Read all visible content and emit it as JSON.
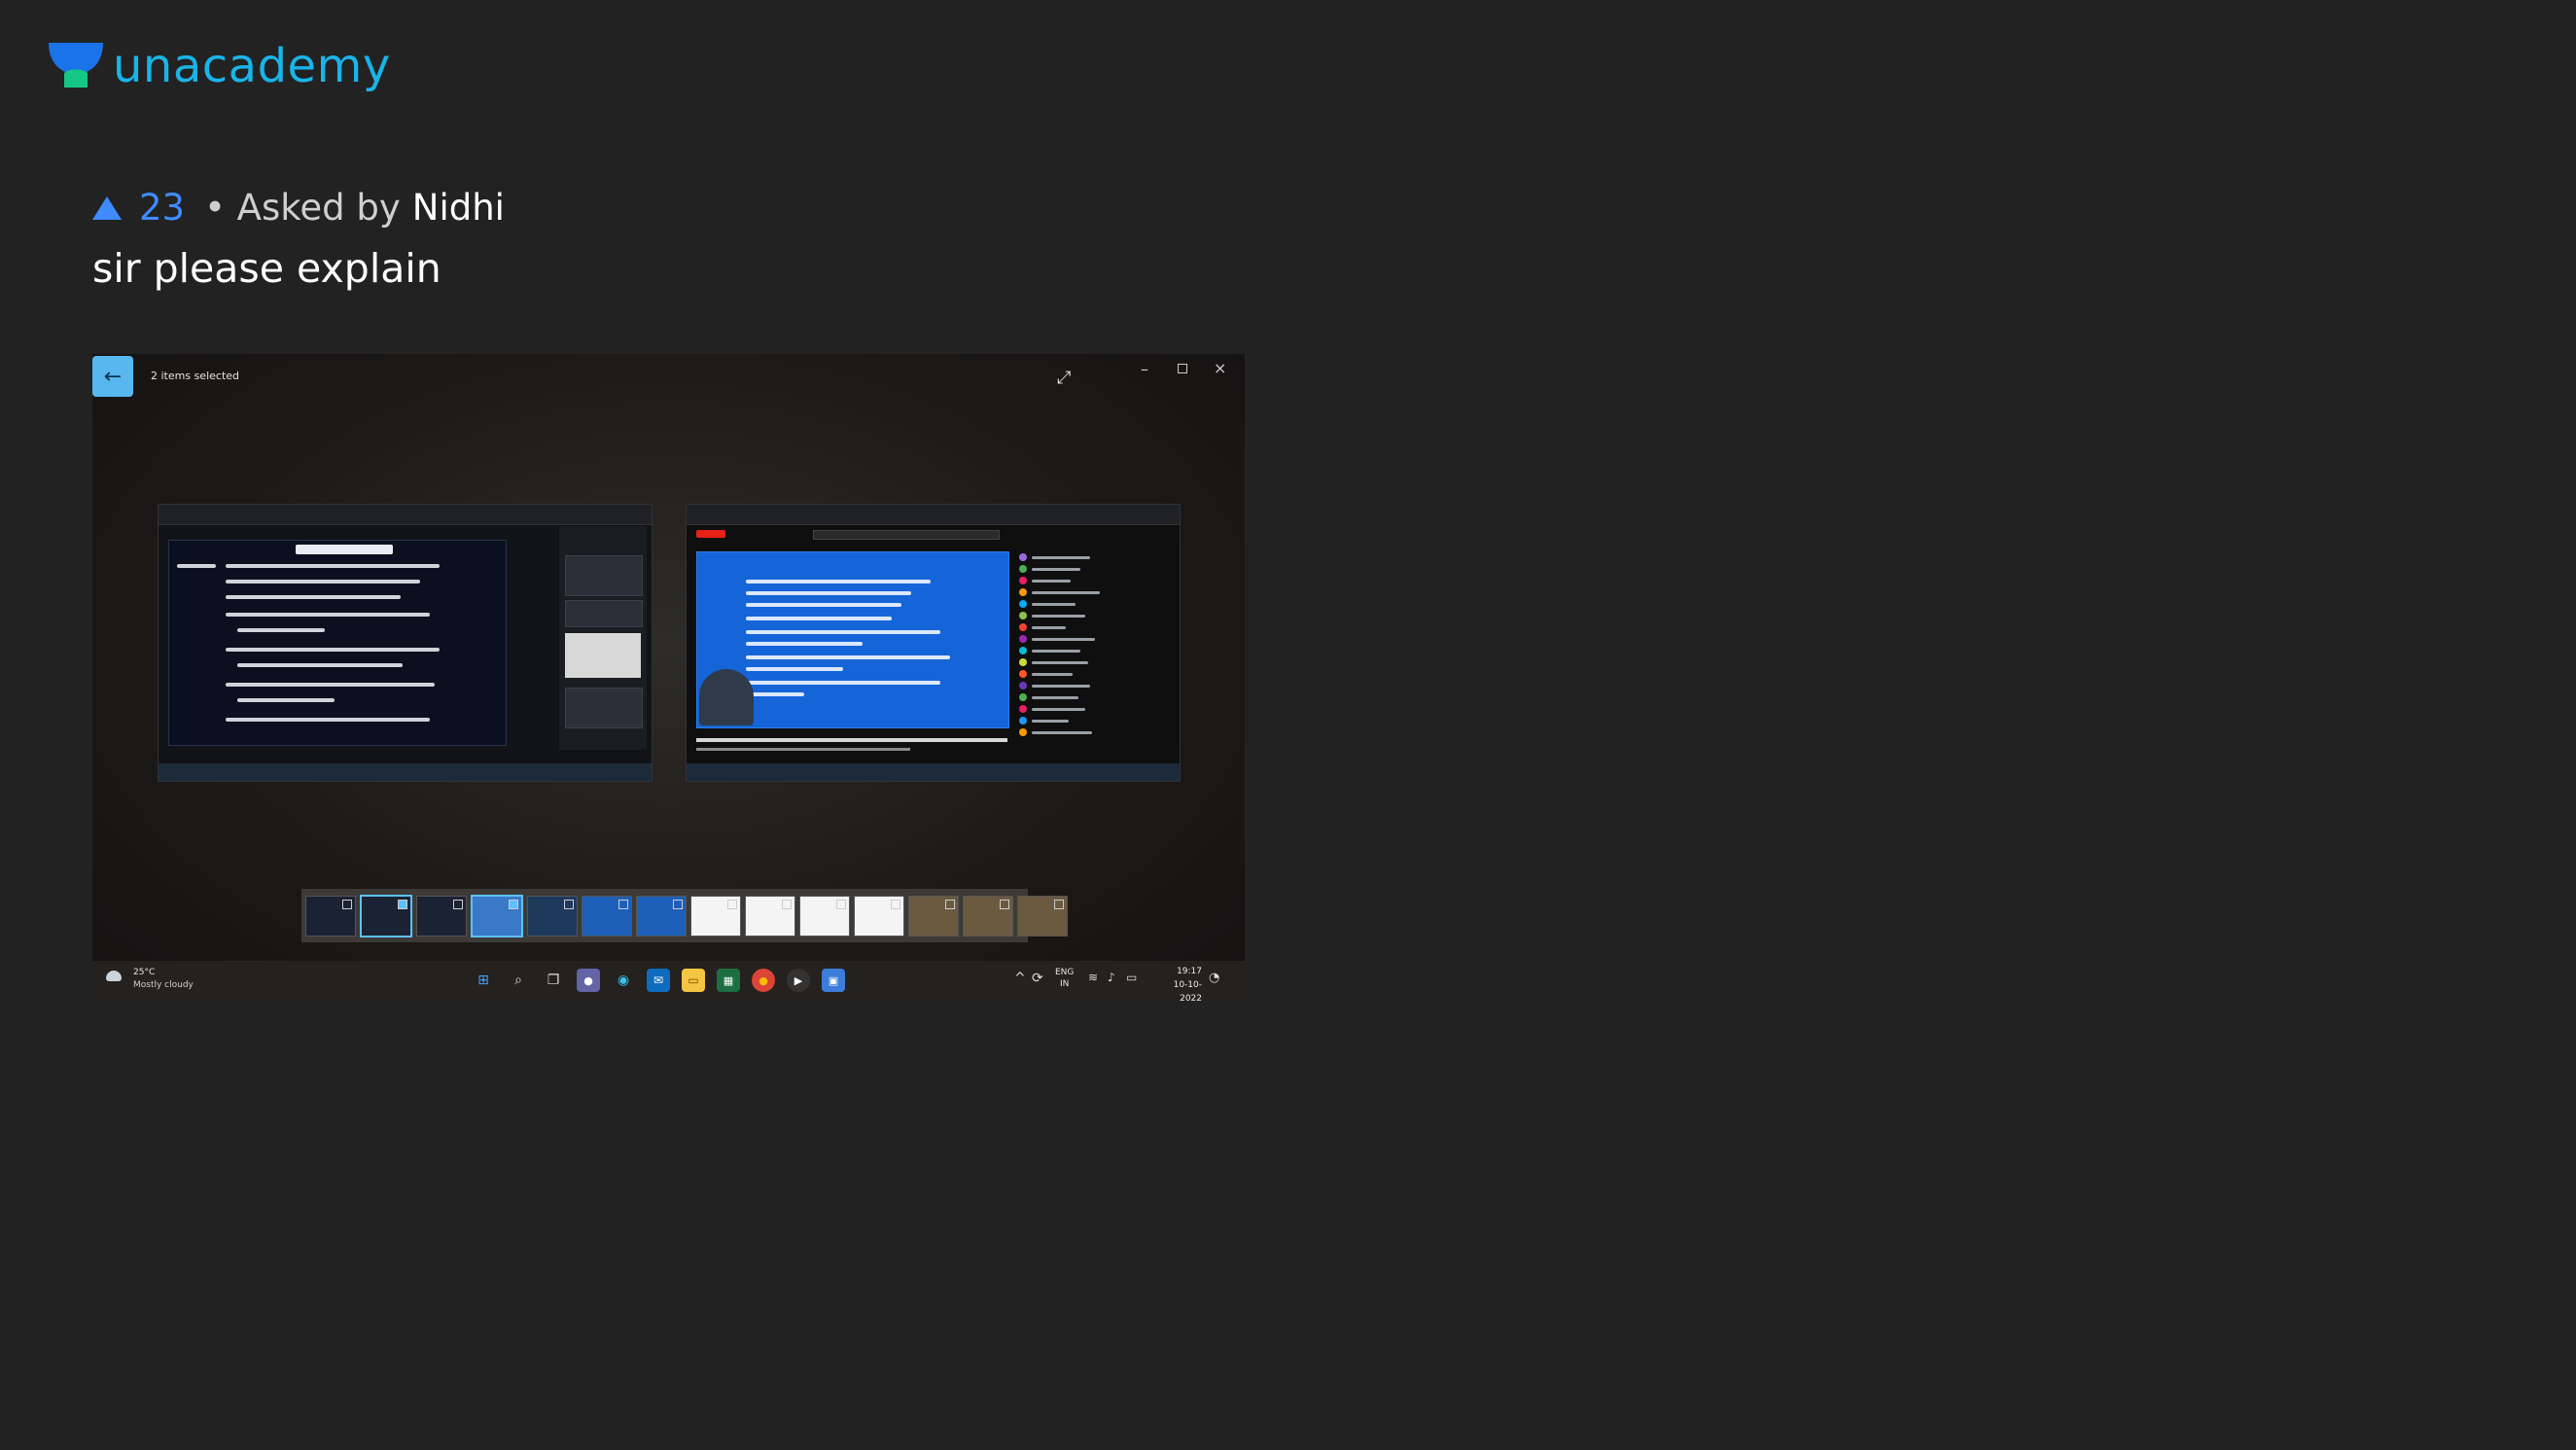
{
  "brand": {
    "name": "unacademy",
    "color": "#19b4e8",
    "icon": "unacademy-logo-icon"
  },
  "question": {
    "upvotes": "23",
    "asked_prefix": "• Asked by",
    "author": "Nidhi",
    "text": "sir please explain",
    "accent": "#3f8bff"
  },
  "attachment": {
    "photos_app": {
      "selection_text": "2 items selected",
      "back_icon": "arrow-left-icon",
      "expand_icon": "expand-icon",
      "window_controls": [
        "minimize-icon",
        "maximize-icon",
        "close-icon"
      ]
    },
    "filmstrip": {
      "count": 14,
      "selected_indices": [
        1,
        3
      ],
      "selected_color": "#5cc1ff"
    },
    "taskbar": {
      "weather_temp": "25°C",
      "weather_desc": "Mostly cloudy",
      "pinned_icons": [
        "windows-start-icon",
        "search-icon",
        "task-view-icon",
        "chat-icon",
        "edge-icon",
        "mail-icon",
        "file-explorer-icon",
        "excel-icon",
        "chrome-icon",
        "media-player-icon",
        "photos-icon"
      ],
      "lang_top": "ENG",
      "lang_bottom": "IN",
      "time": "19:17",
      "date": "10-10-2022"
    }
  }
}
